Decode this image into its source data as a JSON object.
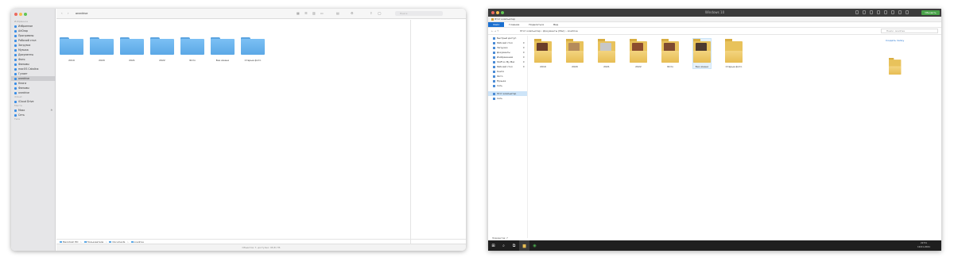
{
  "mac": {
    "title": "onedrive",
    "search_placeholder": "Поиск",
    "traffic": [
      "#ec6a5e",
      "#f4bf4f",
      "#61c554"
    ],
    "sidebar": {
      "sections": [
        {
          "header": "Избранное",
          "items": [
            {
              "label": "Избранное",
              "selected": false
            },
            {
              "label": "AirDrop",
              "selected": false
            },
            {
              "label": "Программы",
              "selected": false
            },
            {
              "label": "Рабочий стол",
              "selected": false
            },
            {
              "label": "Загрузки",
              "selected": false
            },
            {
              "label": "Музыка",
              "selected": false
            },
            {
              "label": "Документы",
              "selected": false
            },
            {
              "label": "Фото",
              "selected": false
            },
            {
              "label": "Фильмы",
              "selected": false
            },
            {
              "label": "macOS Catalina",
              "selected": false
            },
            {
              "label": "Гуляет",
              "selected": false
            },
            {
              "label": "onedrive",
              "selected": true
            },
            {
              "label": "Книги",
              "selected": false
            },
            {
              "label": "Фильмы",
              "selected": false
            },
            {
              "label": "onedrive",
              "selected": false
            }
          ]
        },
        {
          "header": "iCloud",
          "items": [
            {
              "label": "iCloud Drive",
              "selected": false
            }
          ]
        },
        {
          "header": "Места",
          "items": [
            {
              "label": "Макс",
              "selected": false,
              "badge": "≙"
            },
            {
              "label": "Сеть",
              "selected": false
            }
          ]
        },
        {
          "header": "Теги",
          "items": []
        }
      ]
    },
    "folders": [
      "2019",
      "2020",
      "2021",
      "2022",
      "Фото",
      "Без имени",
      "Старые фото"
    ],
    "path": [
      "Macintosh HD",
      "Пользователи",
      "Documents",
      "onedrive"
    ],
    "status": "Объектов: 7, доступно: 45,81 ГБ"
  },
  "win": {
    "title": "Windows 10",
    "strip": "Этот компьютер",
    "ribbon": [
      "Файл",
      "Главная",
      "Поделиться",
      "Вид"
    ],
    "nav_back": "← → ↑",
    "address": "Этот компьютер › Документы (Mac) › onedrive",
    "search_placeholder": "Поиск: onedrive",
    "install_label": "Обновить",
    "nav": [
      {
        "label": "Быстрый доступ",
        "selected": false
      },
      {
        "label": "Рабочий стол",
        "selected": false,
        "pin": "✱"
      },
      {
        "label": "Загрузки",
        "selected": false,
        "pin": "✱"
      },
      {
        "label": "Документы",
        "selected": false,
        "pin": "✱"
      },
      {
        "label": "Изображения",
        "selected": false,
        "pin": "✱"
      },
      {
        "label": "Stuff on My Mac",
        "selected": false,
        "pin": "✱"
      },
      {
        "label": "Рабочий стол",
        "selected": false,
        "pin": "✱"
      },
      {
        "label": "Книги",
        "selected": false
      },
      {
        "label": "Фото",
        "selected": false
      },
      {
        "label": "Музыка",
        "selected": false
      },
      {
        "label": "Сеть",
        "selected": false
      },
      {
        "label": "Этот компьютер",
        "selected": true
      },
      {
        "label": "Сеть",
        "selected": false
      }
    ],
    "folders": [
      {
        "label": "2019",
        "pic": "#6b3e2a"
      },
      {
        "label": "2020",
        "pic": "#b58b5b"
      },
      {
        "label": "2021",
        "pic": "#c7c7c7"
      },
      {
        "label": "2022",
        "pic": "#8c4c2e"
      },
      {
        "label": "Фото",
        "pic": "#7e4a2f"
      },
      {
        "label": "Без имени",
        "pic": "#4d3a2f",
        "selected": true
      },
      {
        "label": "Старые фото",
        "pic": "none"
      }
    ],
    "right_pane_link": "Создать папку",
    "status": "Элементов: 7",
    "clock_time": "22:51",
    "clock_date": "19.01.2021"
  }
}
